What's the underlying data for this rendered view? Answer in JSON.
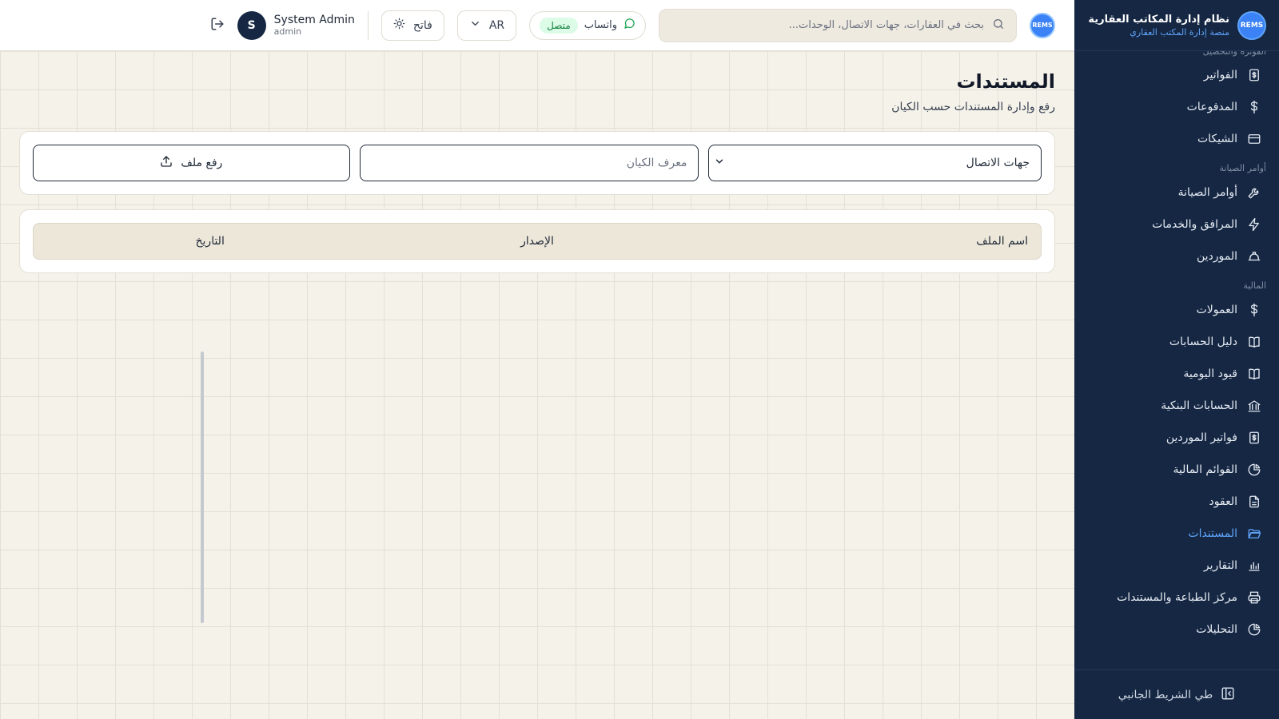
{
  "brand": {
    "logo_text": "REMS",
    "title": "نظام إدارة المكاتب العقارية",
    "subtitle": "منصة إدارة المكتب العقاري"
  },
  "sidebar": {
    "cut_section": "الفوترة والتحصيل",
    "groups": [
      {
        "section": "",
        "items": [
          {
            "label": "الفواتير",
            "icon": "invoice-icon"
          },
          {
            "label": "المدفوعات",
            "icon": "dollar-icon"
          },
          {
            "label": "الشيكات",
            "icon": "card-icon"
          }
        ]
      },
      {
        "section": "أوامر الصيانة",
        "items": [
          {
            "label": "أوامر الصيانة",
            "icon": "wrench-icon"
          },
          {
            "label": "المرافق والخدمات",
            "icon": "bolt-icon"
          },
          {
            "label": "الموردين",
            "icon": "hardhat-icon"
          }
        ]
      },
      {
        "section": "المالية",
        "items": [
          {
            "label": "العمولات",
            "icon": "dollar-icon"
          },
          {
            "label": "دليل الحسابات",
            "icon": "book-icon"
          },
          {
            "label": "قيود اليومية",
            "icon": "book-icon"
          },
          {
            "label": "الحسابات البنكية",
            "icon": "bank-icon"
          },
          {
            "label": "فواتير الموردين",
            "icon": "invoice-icon"
          },
          {
            "label": "القوائم المالية",
            "icon": "pie-icon"
          }
        ]
      },
      {
        "section": "",
        "items": [
          {
            "label": "العقود",
            "icon": "file-icon"
          },
          {
            "label": "المستندات",
            "icon": "folder-icon",
            "active": true
          },
          {
            "label": "التقارير",
            "icon": "bar-chart-icon"
          },
          {
            "label": "مركز الطباعة والمستندات",
            "icon": "printer-icon"
          },
          {
            "label": "التحليلات",
            "icon": "pie-icon"
          }
        ]
      }
    ],
    "collapse_label": "طي الشريط الجانبي"
  },
  "header": {
    "search_placeholder": "بحث في العقارات، جهات الاتصال، الوحدات...",
    "whatsapp_label": "واتساب",
    "whatsapp_status": "متصل",
    "lang": "AR",
    "theme_label": "فاتح",
    "user_name": "System Admin",
    "user_role": "admin",
    "user_initial": "S"
  },
  "page": {
    "title": "المستندات",
    "subtitle": "رفع وإدارة المستندات حسب الكيان",
    "entity_type_selected": "جهات الاتصال",
    "entity_id_placeholder": "معرف الكيان",
    "upload_label": "رفع ملف",
    "table": {
      "columns": [
        "اسم الملف",
        "الإصدار",
        "التاريخ"
      ]
    }
  },
  "colors": {
    "sidebar_bg": "#152743",
    "accent": "#60a5fa",
    "page_bg": "#f5f2ea",
    "status_ok": "#15803d"
  }
}
